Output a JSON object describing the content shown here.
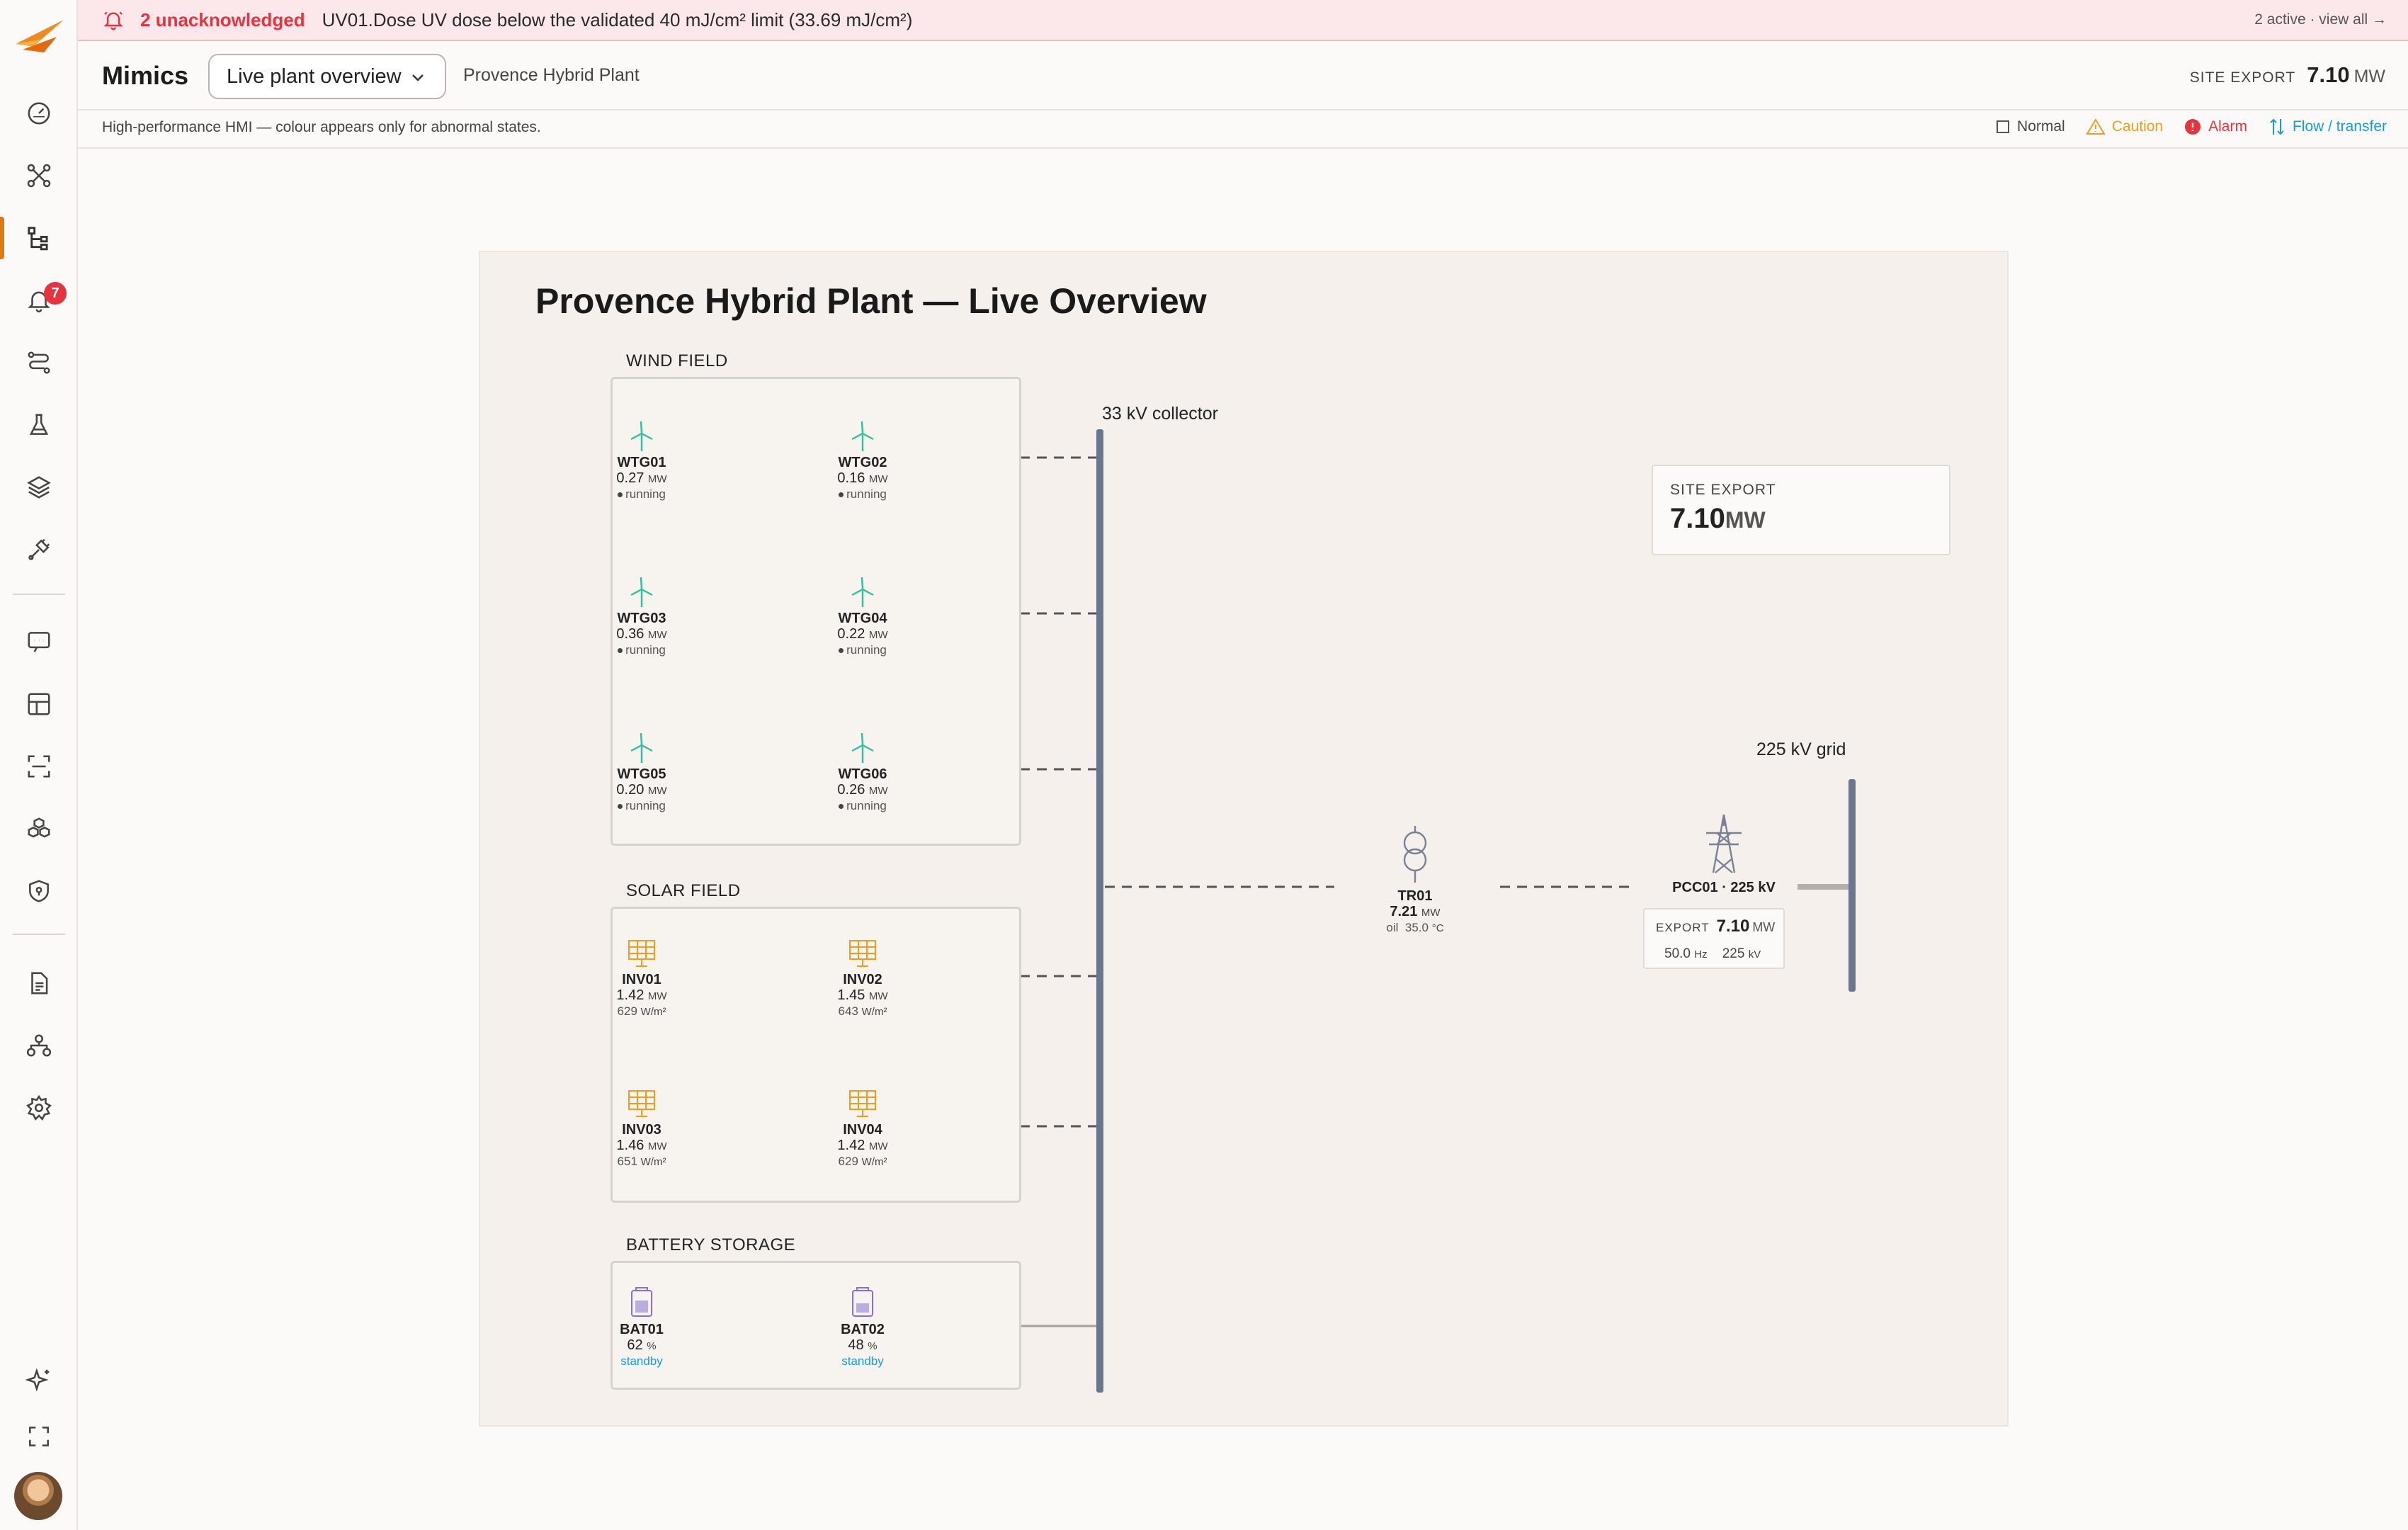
{
  "alarm_banner": {
    "unacknowledged": "2 unacknowledged",
    "message": "UV01.Dose UV dose below the validated 40 mJ/cm² limit (33.69 mJ/cm²)",
    "view_all": "2 active · view all →"
  },
  "sidebar": {
    "alarm_badge": "7",
    "items": [
      {
        "icon": "gauge-icon"
      },
      {
        "icon": "network-nodes-icon"
      },
      {
        "icon": "mimics-icon",
        "active": true
      },
      {
        "icon": "bell-icon"
      },
      {
        "icon": "route-icon"
      },
      {
        "icon": "flask-icon"
      },
      {
        "icon": "layers-icon"
      },
      {
        "icon": "plug-icon"
      },
      {
        "icon": "chat-icon"
      },
      {
        "icon": "grid-icon"
      },
      {
        "icon": "scan-icon"
      },
      {
        "icon": "cubes-icon"
      },
      {
        "icon": "shield-icon"
      },
      {
        "icon": "document-icon"
      },
      {
        "icon": "hierarchy-icon"
      },
      {
        "icon": "gear-icon"
      },
      {
        "icon": "sparkle-icon"
      },
      {
        "icon": "fullscreen-icon"
      }
    ]
  },
  "header": {
    "title": "Mimics",
    "selected_mimic": "Live plant overview",
    "plant_name": "Provence Hybrid Plant",
    "export_label": "SITE EXPORT",
    "export_value": "7.10",
    "export_unit": "MW"
  },
  "legend_bar": {
    "hint": "High-performance HMI — colour appears only for abnormal states.",
    "normal": "Normal",
    "caution": "Caution",
    "alarm": "Alarm",
    "flow": "Flow / transfer"
  },
  "colors": {
    "caution": "#e8a020",
    "alarm": "#e5343f",
    "flow": "#1a9ad6",
    "wind": "#2fbf9f",
    "solar": "#e8a020",
    "battery": "#8a6fd1",
    "bus": "#6a7590"
  },
  "mimic": {
    "title": "Provence Hybrid Plant — Live Overview",
    "wind_field_label": "WIND FIELD",
    "solar_field_label": "SOLAR FIELD",
    "battery_label": "BATTERY STORAGE",
    "collector_label": "33 kV collector",
    "grid_label": "225 kV grid",
    "site_export": {
      "label": "SITE EXPORT",
      "value": "7.10",
      "unit": "MW"
    },
    "turbines": [
      {
        "name": "WTG01",
        "power": "0.27",
        "unit": "MW",
        "status": "running"
      },
      {
        "name": "WTG02",
        "power": "0.16",
        "unit": "MW",
        "status": "running"
      },
      {
        "name": "WTG03",
        "power": "0.36",
        "unit": "MW",
        "status": "running"
      },
      {
        "name": "WTG04",
        "power": "0.22",
        "unit": "MW",
        "status": "running"
      },
      {
        "name": "WTG05",
        "power": "0.20",
        "unit": "MW",
        "status": "running"
      },
      {
        "name": "WTG06",
        "power": "0.26",
        "unit": "MW",
        "status": "running"
      }
    ],
    "inverters": [
      {
        "name": "INV01",
        "power": "1.42",
        "unit": "MW",
        "irradiance": "629",
        "irr_unit": "W/m²"
      },
      {
        "name": "INV02",
        "power": "1.45",
        "unit": "MW",
        "irradiance": "643",
        "irr_unit": "W/m²"
      },
      {
        "name": "INV03",
        "power": "1.46",
        "unit": "MW",
        "irradiance": "651",
        "irr_unit": "W/m²"
      },
      {
        "name": "INV04",
        "power": "1.42",
        "unit": "MW",
        "irradiance": "629",
        "irr_unit": "W/m²"
      }
    ],
    "batteries": [
      {
        "name": "BAT01",
        "soc": "62",
        "unit": "%",
        "status": "standby"
      },
      {
        "name": "BAT02",
        "soc": "48",
        "unit": "%",
        "status": "standby"
      }
    ],
    "transformer": {
      "name": "TR01",
      "power": "7.21",
      "unit": "MW",
      "oil_label": "oil",
      "oil_temp": "35.0",
      "temp_unit": "°C"
    },
    "pcc": {
      "name": "PCC01 · 225 kV",
      "export_label": "EXPORT",
      "export_value": "7.10",
      "export_unit": "MW",
      "frequency": "50.0",
      "freq_unit": "Hz",
      "voltage": "225",
      "volt_unit": "kV"
    }
  }
}
